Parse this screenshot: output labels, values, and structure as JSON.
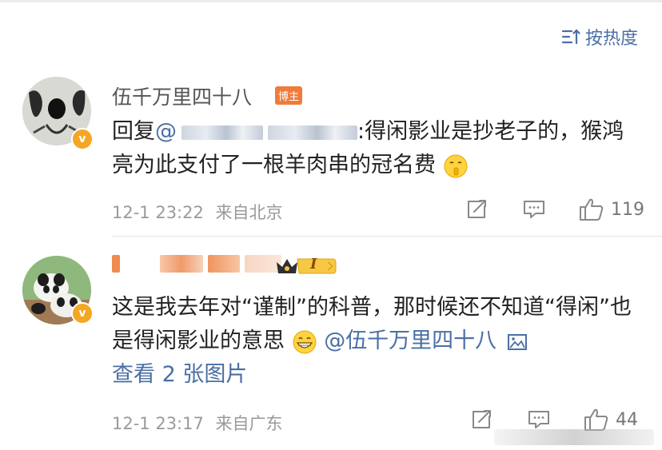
{
  "sort": {
    "label": "按热度",
    "icon": "sort-lines-icon"
  },
  "comments": [
    {
      "author": "伍千万里四十八",
      "badge": "博主",
      "verified_icon": "v-badge-icon",
      "reply_prefix": "回复",
      "mention_prefix": "@",
      "text_after": ":得闲影业是抄老子的，猴鸿亮为此支付了一根羊肉串的冠名费",
      "emoji": "shush-face-emoji",
      "time": "12-1 23:22",
      "location": "来自北京",
      "likes": "119"
    },
    {
      "author_hidden": true,
      "rank_badge": "crown-level-badge",
      "rank_text": "I",
      "verified_icon": "v-badge-icon",
      "text": "这是我去年对“谨制”的科普，那时候还不知道“得闲”也是得闲影业的意思",
      "emoji": "grin-face-emoji",
      "mention": "@伍千万里四十八",
      "image_icon": "image-icon",
      "view_images": "查看 2 张图片",
      "time": "12-1 23:17",
      "location": "来自广东",
      "likes": "44"
    }
  ],
  "colors": {
    "link": "#4a6fa5",
    "badge": "#f07b3a",
    "verified": "#f5a623"
  }
}
